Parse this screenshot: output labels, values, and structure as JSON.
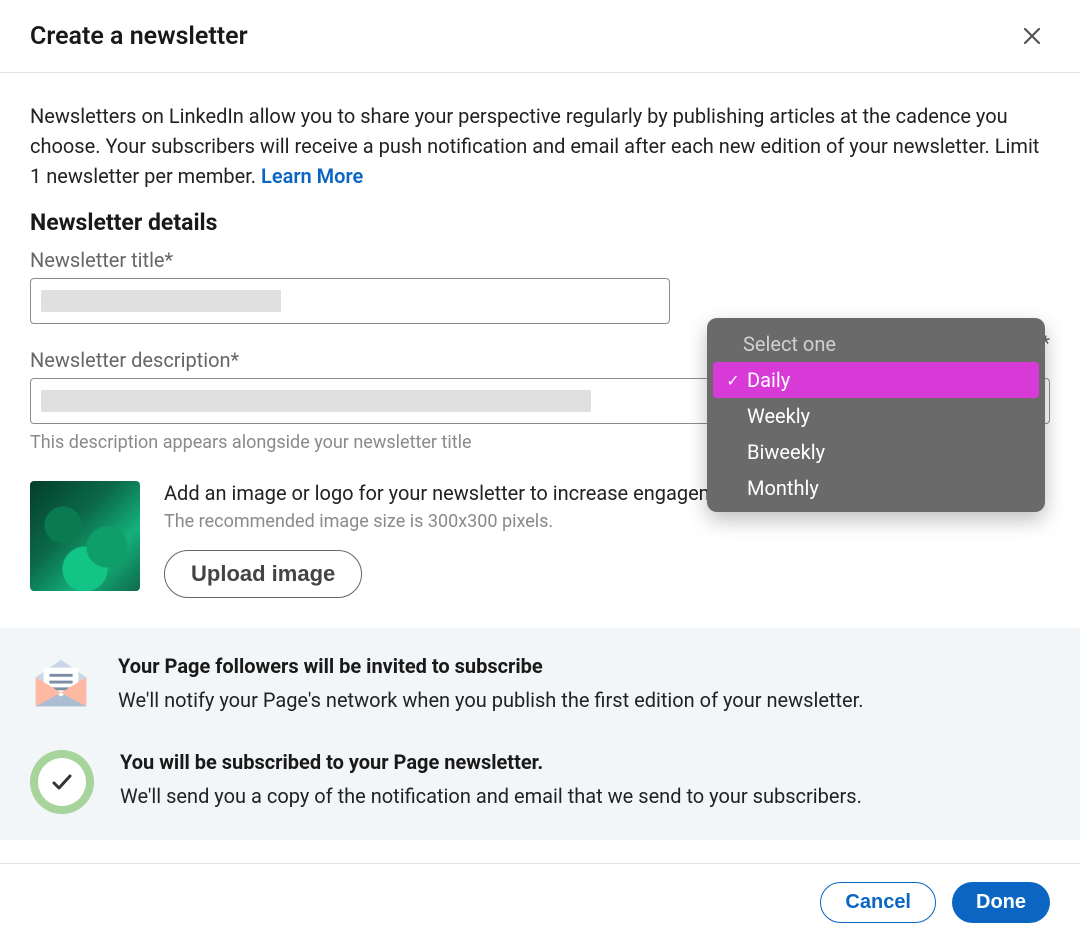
{
  "header": {
    "title": "Create a newsletter"
  },
  "intro": {
    "text": "Newsletters on LinkedIn allow you to share your perspective regularly by publishing articles at the cadence you choose. Your subscribers will receive a push notification and email after each new edition of your newsletter. Limit 1 newsletter per member. ",
    "learn_more": "Learn More"
  },
  "details": {
    "heading": "Newsletter details",
    "title_label": "Newsletter title*",
    "right_asterisk": "*",
    "description_label": "Newsletter description*",
    "description_helper": "This description appears alongside your newsletter title"
  },
  "upload": {
    "title": "Add an image or logo for your newsletter to increase engagement.",
    "hint": "The recommended image size is 300x300 pixels.",
    "button": "Upload image"
  },
  "info": {
    "item1_title": "Your Page followers will be invited to subscribe",
    "item1_text": "We'll notify your Page's network when you publish the first edition of your newsletter.",
    "item2_title": "You will be subscribed to your Page newsletter.",
    "item2_text": "We'll send you a copy of the notification and email that we send to your subscribers."
  },
  "footer": {
    "cancel": "Cancel",
    "done": "Done"
  },
  "dropdown": {
    "placeholder": "Select one",
    "options": {
      "0": "Daily",
      "1": "Weekly",
      "2": "Biweekly",
      "3": "Monthly"
    },
    "selected_index": 0
  }
}
